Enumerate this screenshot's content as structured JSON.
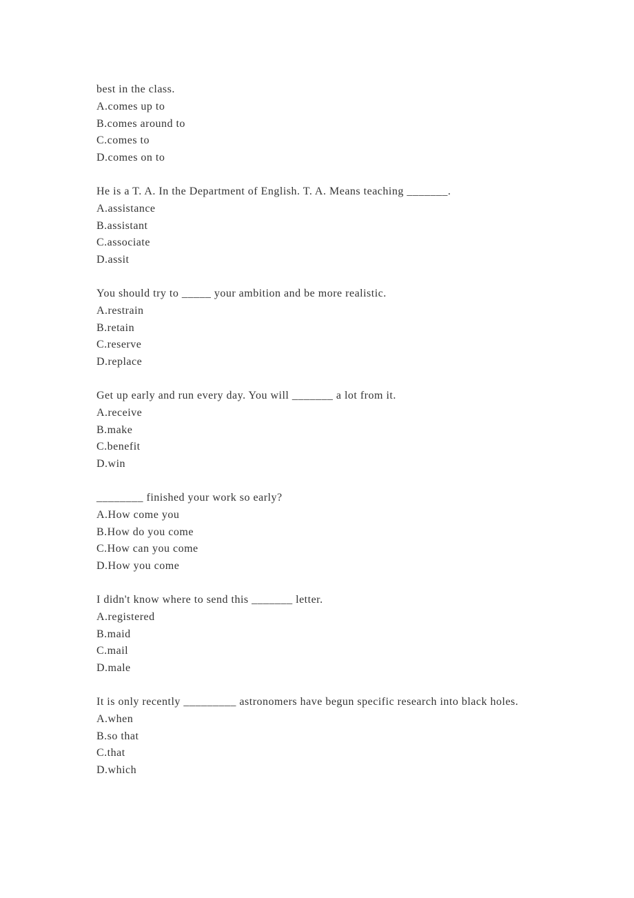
{
  "questions": [
    {
      "stem": "best in the class.",
      "options": [
        "A.comes up to",
        "B.comes around to",
        "C.comes to",
        "D.comes on to"
      ]
    },
    {
      "stem": "He is a T. A. In the Department of English. T. A. Means teaching _______.",
      "options": [
        "A.assistance",
        "B.assistant",
        "C.associate",
        "D.assit"
      ]
    },
    {
      "stem": "You should try to _____ your ambition and be more realistic.",
      "options": [
        "A.restrain",
        "B.retain",
        "C.reserve",
        "D.replace"
      ]
    },
    {
      "stem": "Get up early and run every day. You will _______ a lot from it.",
      "options": [
        "A.receive",
        "B.make",
        "C.benefit",
        "D.win"
      ]
    },
    {
      "stem": "________ finished your work so early?",
      "options": [
        "A.How come you",
        "B.How do you come",
        "C.How can you come",
        "D.How you come"
      ]
    },
    {
      "stem": "I didn't know where to send this _______ letter.",
      "options": [
        "A.registered",
        "B.maid",
        "C.mail",
        "D.male"
      ]
    },
    {
      "stem": "It is only recently _________ astronomers have begun specific research into black holes.",
      "options": [
        "A.when",
        "B.so that",
        "C.that",
        "D.which"
      ]
    }
  ]
}
